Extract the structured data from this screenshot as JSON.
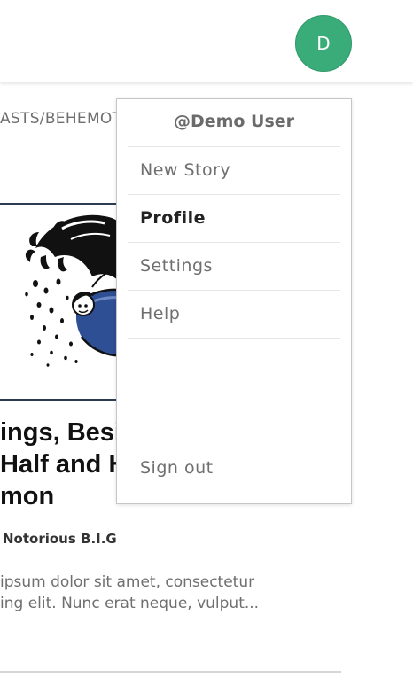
{
  "header": {
    "avatar_initial": "D",
    "avatar_color": "#3aac79"
  },
  "breadcrumb": {
    "text": "ASTS/BEHEMOTH"
  },
  "story": {
    "image_icon": "cartoon-splash-illustration",
    "title_lines": [
      "ings, Besides",
      "Half and Half",
      "mon"
    ],
    "author": "Notorious B.I.G",
    "excerpt_lines": [
      "ipsum dolor sit amet, consectetur",
      "ing elit. Nunc erat neque, vulput..."
    ]
  },
  "dropdown": {
    "username": "@Demo User",
    "items": [
      {
        "label": "New Story"
      },
      {
        "label": "Profile"
      },
      {
        "label": "Settings"
      },
      {
        "label": "Help"
      }
    ],
    "sign_out": "Sign out"
  }
}
